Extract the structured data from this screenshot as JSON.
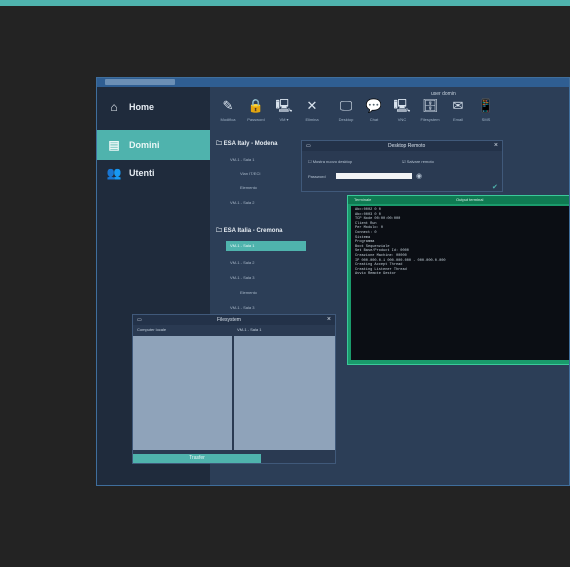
{
  "colors": {
    "accent": "#4fb3ad",
    "background": "#232323",
    "app_bg": "#2c3e57",
    "sidebar_bg": "#1f2b3c",
    "terminal_bg": "#0b0e14"
  },
  "user": "user  domin",
  "sidebar": {
    "items": [
      {
        "label": "Home",
        "icon": "home-icon"
      },
      {
        "label": "Domini",
        "icon": "server-icon"
      },
      {
        "label": "Utenti",
        "icon": "users-icon"
      }
    ]
  },
  "toolbar": {
    "items": [
      {
        "label": "Modifica",
        "glyph": "✎",
        "icon": "edit-icon"
      },
      {
        "label": "Password",
        "glyph": "🔒",
        "icon": "lock-icon"
      },
      {
        "label": "VM ▾",
        "glyph": "🖳",
        "icon": "vm-icon"
      },
      {
        "label": "Elimina",
        "glyph": "✕",
        "icon": "delete-icon"
      },
      {
        "label": "Desktop",
        "glyph": "🖵",
        "icon": "desktop-icon"
      },
      {
        "label": "Chat",
        "glyph": "💬",
        "icon": "chat-icon"
      },
      {
        "label": "VNC",
        "glyph": "🖳",
        "icon": "vnc-icon"
      },
      {
        "label": "Filesystem",
        "glyph": "🗄",
        "icon": "filesystem-icon"
      },
      {
        "label": "Email",
        "glyph": "✉",
        "icon": "email-icon"
      },
      {
        "label": "SMS",
        "glyph": "📱",
        "icon": "sms-icon"
      }
    ]
  },
  "tree": {
    "group1": "ESA Italy - Modena",
    "group1_nodes": [
      "VM-1 - Sala 1",
      "Vlan IT/ECI",
      "Elemento",
      "VM-1 - Sala 2"
    ],
    "group2": "ESA Italia - Cremona",
    "group2_nodes": [
      "VM-1 - Sala 1",
      "VM-1 - Sala 2",
      "VM-1 - Sala 3",
      "Elemento",
      "VM-1 - Sala 3"
    ]
  },
  "desktop_dialog": {
    "title": "Desktop Remoto",
    "option1": "Mostra nuovo desktop",
    "option2": "Salvare remoto",
    "password_label": "Password"
  },
  "terminal": {
    "title": "Terminale",
    "header_right": "Output terminal",
    "lines": [
      "Abc:0002   0   0",
      "Abc:0003   0   0",
      "",
      "TCP Node 00:00:00:000",
      "Client Run",
      "Per Modulo: 0",
      "Connect: 0",
      "Sistema",
      "Programma",
      "Boot Sequenziale",
      "Set Base/Product Id: 0000",
      "Creazione Machine: 00000",
      "IP 000.000.0.1 000.000.000 - 000.000.0.000",
      "Creating Accept Thread",
      "Creating Listener Thread",
      "Avvio Remote Gestor"
    ]
  },
  "files_dialog": {
    "title": "Filesystem",
    "col1": "Computer locale",
    "col2": "VM-1 - Sala 1",
    "button": "Trasfer"
  }
}
